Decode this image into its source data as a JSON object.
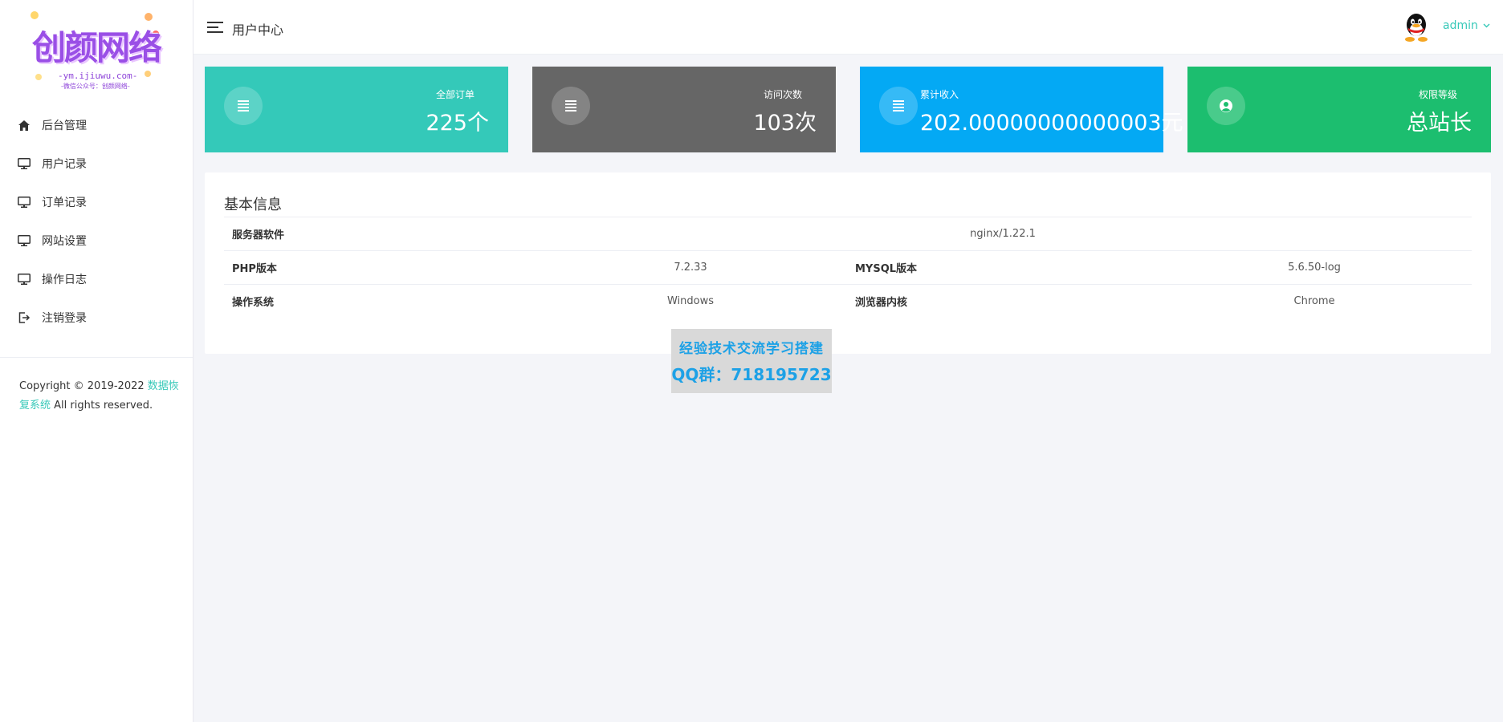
{
  "sidebar": {
    "logo": {
      "title": "创颜网络",
      "site": "-ym.ijiuwu.com-",
      "wechat": "-微信公众号：创颜网络-"
    },
    "items": [
      {
        "label": "后台管理",
        "icon": "home-icon"
      },
      {
        "label": "用户记录",
        "icon": "monitor-icon"
      },
      {
        "label": "订单记录",
        "icon": "monitor-icon"
      },
      {
        "label": "网站设置",
        "icon": "monitor-icon"
      },
      {
        "label": "操作日志",
        "icon": "monitor-icon"
      },
      {
        "label": "注销登录",
        "icon": "logout-icon"
      }
    ],
    "copyright": {
      "prefix": "Copyright © 2019-2022 ",
      "link": "数据恢复系统",
      "suffix": " All rights reserved."
    }
  },
  "header": {
    "title": "用户中心",
    "user": "admin"
  },
  "cards": [
    {
      "label": "全部订单",
      "value": "225个",
      "color": "#34c9b9",
      "icon": "list-icon"
    },
    {
      "label": "访问次数",
      "value": "103次",
      "color": "#666666",
      "icon": "list-icon"
    },
    {
      "label": "累计收入",
      "value": "202.00000000000003元",
      "color": "#04a9f4",
      "icon": "list-icon"
    },
    {
      "label": "权限等级",
      "value": "总站长",
      "color": "#1cbe6f",
      "icon": "user-circle-icon"
    }
  ],
  "info": {
    "title": "基本信息",
    "server_label": "服务器软件",
    "server_value": "nginx/1.22.1",
    "php_label": "PHP版本",
    "php_value": "7.2.33",
    "mysql_label": "MYSQL版本",
    "mysql_value": "5.6.50-log",
    "os_label": "操作系统",
    "os_value": "Windows",
    "browser_label": "浏览器内核",
    "browser_value": "Chrome"
  },
  "watermark": {
    "line1": "经验技术交流学习搭建",
    "line2": "QQ群：718195723"
  }
}
